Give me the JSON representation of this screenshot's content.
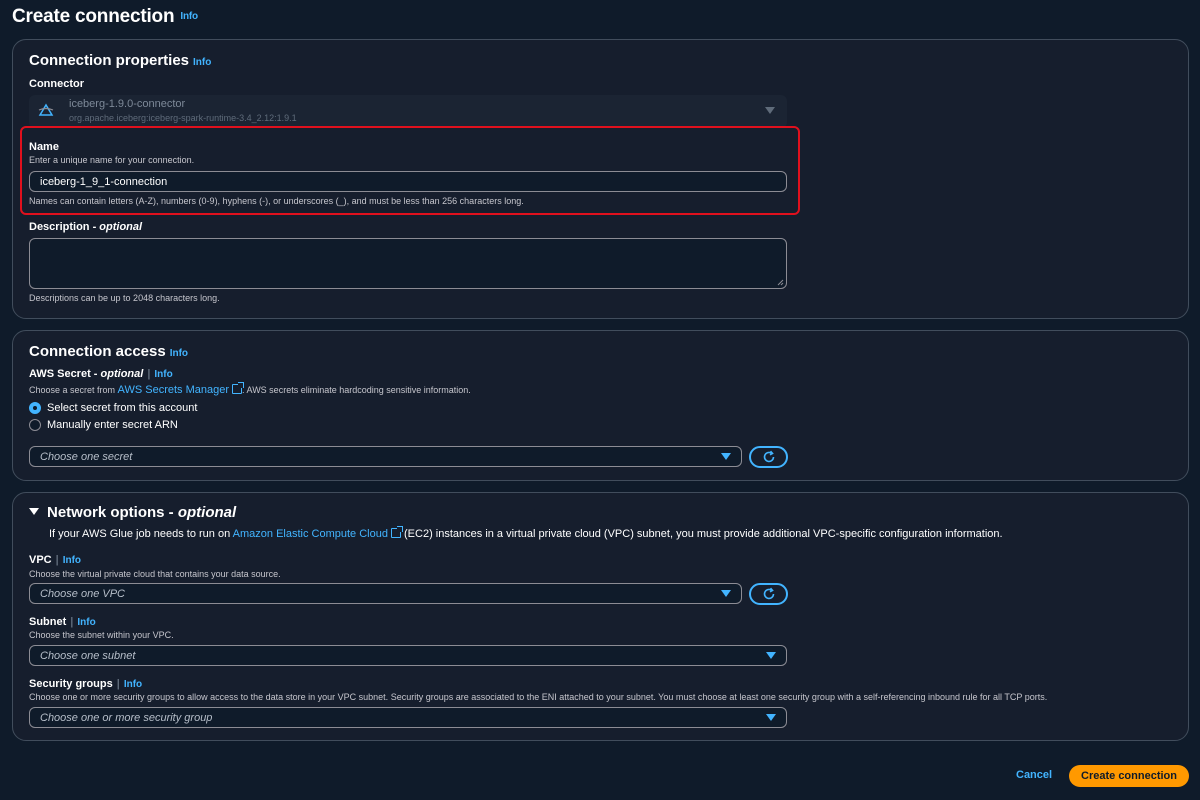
{
  "page": {
    "title": "Create connection",
    "info": "Info"
  },
  "connection_properties": {
    "heading": "Connection properties",
    "info": "Info",
    "connector_label": "Connector",
    "connector_name": "iceberg-1.9.0-connector",
    "connector_sub": "org.apache.iceberg:iceberg-spark-runtime-3.4_2.12:1.9.1",
    "name_label": "Name",
    "name_hint": "Enter a unique name for your connection.",
    "name_value": "iceberg-1_9_1-connection",
    "name_constraint": "Names can contain letters (A-Z), numbers (0-9), hyphens (-), or underscores (_), and must be less than 256 characters long.",
    "description_label": "Description - ",
    "description_optional": "optional",
    "description_value": "",
    "description_constraint": "Descriptions can be up to 2048 characters long."
  },
  "connection_access": {
    "heading": "Connection access",
    "info": "Info",
    "secret_label": "AWS Secret - ",
    "secret_optional": "optional",
    "secret_info": "Info",
    "secret_hint_prefix": "Choose a secret from ",
    "secret_hint_link": "AWS Secrets Manager",
    "secret_hint_suffix": ". AWS secrets eliminate hardcoding sensitive information.",
    "radio_options": [
      "Select secret from this account",
      "Manually enter secret ARN"
    ],
    "selected_radio": 0,
    "secret_placeholder": "Choose one secret"
  },
  "network_options": {
    "heading": "Network options - ",
    "heading_optional": "optional",
    "desc_prefix": "If your AWS Glue job needs to run on ",
    "desc_link": "Amazon Elastic Compute Cloud",
    "desc_suffix": " (EC2) instances in a virtual private cloud (VPC) subnet, you must provide additional VPC-specific configuration information.",
    "vpc_label": "VPC",
    "vpc_info": "Info",
    "vpc_hint": "Choose the virtual private cloud that contains your data source.",
    "vpc_placeholder": "Choose one VPC",
    "subnet_label": "Subnet",
    "subnet_info": "Info",
    "subnet_hint": "Choose the subnet within your VPC.",
    "subnet_placeholder": "Choose one subnet",
    "sg_label": "Security groups",
    "sg_info": "Info",
    "sg_hint": "Choose one or more security groups to allow access to the data store in your VPC subnet. Security groups are associated to the ENI attached to your subnet. You must choose at least one security group with a self-referencing inbound rule for all TCP ports.",
    "sg_placeholder": "Choose one or more security group"
  },
  "footer": {
    "cancel": "Cancel",
    "create": "Create connection"
  },
  "colors": {
    "background": "#0f1b2a",
    "panel": "#161e2d",
    "accent": "#42b4ff",
    "primary_button": "#ff9900",
    "highlight": "#e0101d"
  }
}
